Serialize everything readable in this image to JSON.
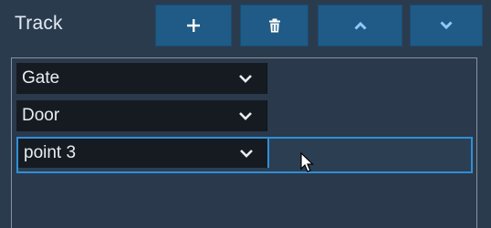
{
  "panel": {
    "title": "Track"
  },
  "toolbar": {
    "buttons": [
      {
        "name": "add",
        "icon": "plus-icon"
      },
      {
        "name": "delete",
        "icon": "trash-icon"
      },
      {
        "name": "move-up",
        "icon": "chevron-up-icon"
      },
      {
        "name": "move-down",
        "icon": "chevron-down-icon"
      }
    ]
  },
  "track_points": [
    {
      "value": "Gate",
      "selected": false
    },
    {
      "value": "Door",
      "selected": false
    },
    {
      "value": "point 3",
      "selected": true
    }
  ],
  "colors": {
    "background": "#2b3b4e",
    "toolbar_button": "#1f5b86",
    "select_bg": "#161b22",
    "selection_border": "#2f8fd8",
    "text": "#e8edf2"
  }
}
